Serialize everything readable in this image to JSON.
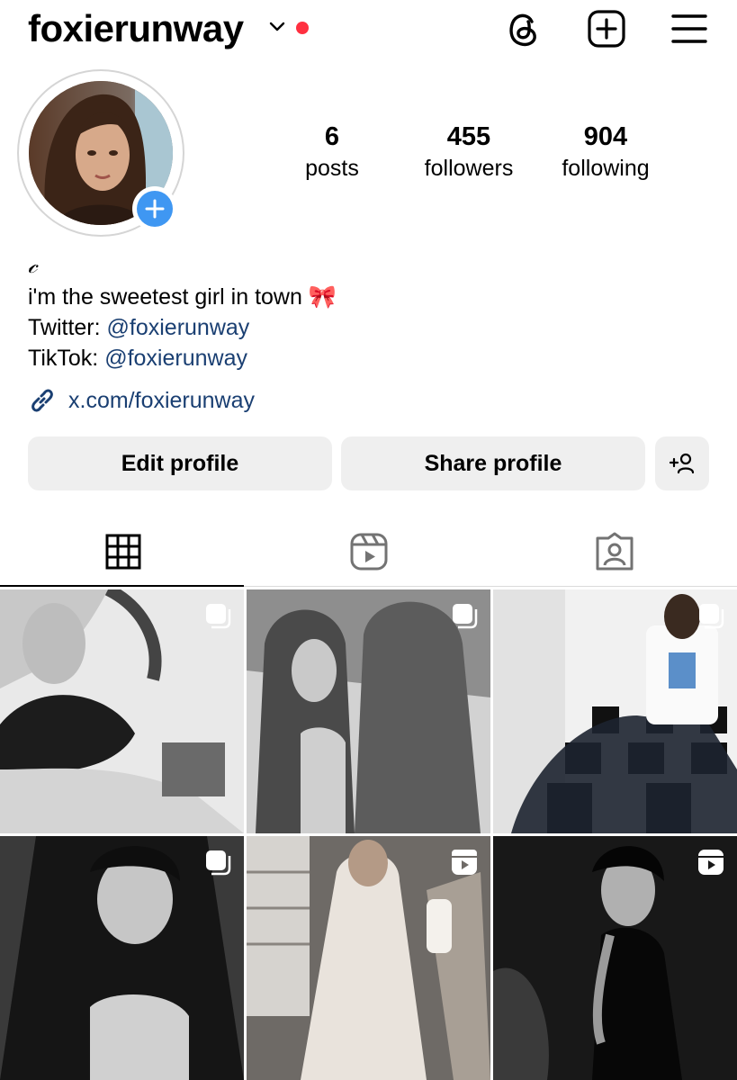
{
  "header": {
    "username": "foxierunway",
    "icons": [
      "chevron-down-icon",
      "threads-icon",
      "new-post-icon",
      "menu-icon"
    ],
    "notification_color": "#ff3040"
  },
  "profile": {
    "stats": [
      {
        "count": "6",
        "label": "posts"
      },
      {
        "count": "455",
        "label": "followers"
      },
      {
        "count": "904",
        "label": "following"
      }
    ],
    "bio": {
      "name_glyph": "𝒸",
      "line1": "i'm the sweetest girl in town 🎀",
      "twitter_prefix": "Twitter: ",
      "twitter_handle": "@foxierunway",
      "tiktok_prefix": "TikTok: ",
      "tiktok_handle": "@foxierunway",
      "link": "x.com/foxierunway"
    }
  },
  "actions": {
    "edit": "Edit profile",
    "share": "Share profile",
    "discover_icon": "add-person-icon"
  },
  "tabs": [
    {
      "name": "grid-icon",
      "active": true
    },
    {
      "name": "reels-icon",
      "active": false
    },
    {
      "name": "tagged-icon",
      "active": false
    }
  ],
  "posts": [
    {
      "badge": "carousel-icon"
    },
    {
      "badge": "carousel-icon"
    },
    {
      "badge": "carousel-icon"
    },
    {
      "badge": "carousel-icon"
    },
    {
      "badge": "reel-icon"
    },
    {
      "badge": "reel-icon"
    }
  ],
  "colors": {
    "link": "#1a3f72",
    "accent": "#3f97f2",
    "button_bg": "#efefef"
  }
}
